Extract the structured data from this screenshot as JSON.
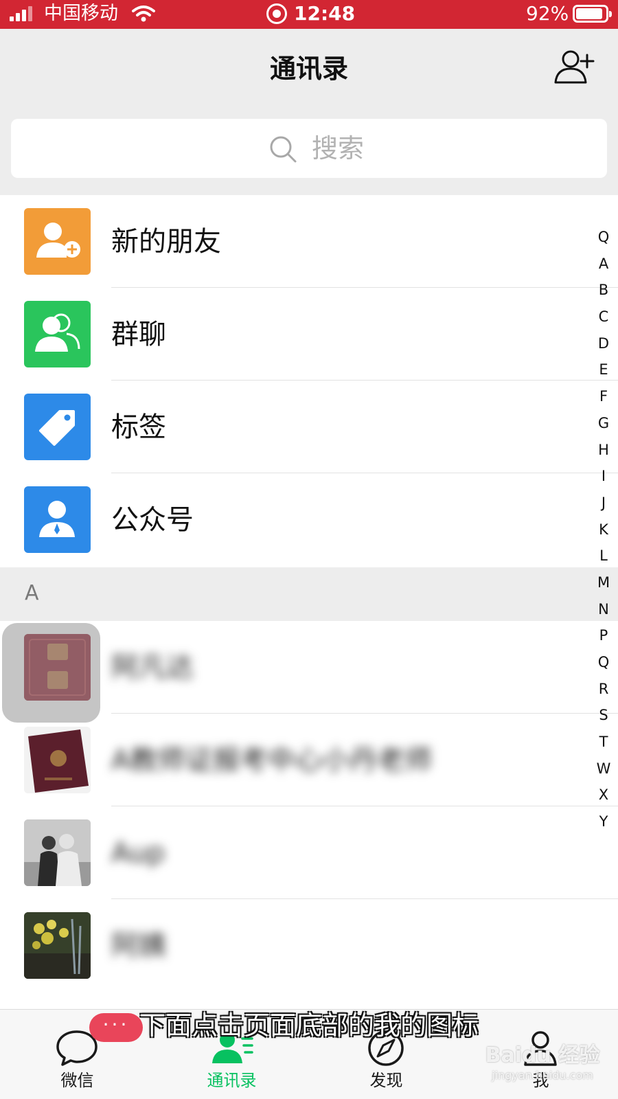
{
  "status_bar": {
    "carrier": "中国移动",
    "time": "12:48",
    "battery_percent": "92%",
    "battery_level": 0.92,
    "background_color": "#d22633",
    "icons": [
      "signal-icon",
      "wifi-icon",
      "screen-record-icon",
      "battery-icon"
    ]
  },
  "header": {
    "title": "通讯录",
    "add_contact_icon": "add-contact-icon"
  },
  "search": {
    "placeholder": "搜索",
    "icon": "search-icon"
  },
  "entries": [
    {
      "label": "新的朋友",
      "icon": "new-friend-icon",
      "color": "#f29c38"
    },
    {
      "label": "群聊",
      "icon": "group-chat-icon",
      "color": "#2ac55c"
    },
    {
      "label": "标签",
      "icon": "tag-icon",
      "color": "#2d8ae8"
    },
    {
      "label": "公众号",
      "icon": "official-account-icon",
      "color": "#2d8ae8"
    }
  ],
  "section": {
    "letter": "A"
  },
  "contacts": [
    {
      "name": "阿凡达",
      "avatar": "avatar-fortune"
    },
    {
      "name": "A教师证报考中心小丹老师",
      "avatar": "avatar-passport"
    },
    {
      "name": "Aup",
      "avatar": "avatar-couple-photo"
    },
    {
      "name": "阿姨",
      "avatar": "avatar-flowers"
    }
  ],
  "index_letters": [
    "Q",
    "A",
    "B",
    "C",
    "D",
    "E",
    "F",
    "G",
    "H",
    "I",
    "J",
    "K",
    "L",
    "M",
    "N",
    "P",
    "Q",
    "R",
    "S",
    "T",
    "W",
    "X",
    "Y"
  ],
  "tabs": [
    {
      "label": "微信",
      "icon": "chat-icon",
      "active": false
    },
    {
      "label": "通讯录",
      "icon": "contacts-icon",
      "active": true
    },
    {
      "label": "发现",
      "icon": "discover-icon",
      "active": false
    },
    {
      "label": "我",
      "icon": "me-icon",
      "active": false
    }
  ],
  "overlay": {
    "subtitle": "下面点击页面底部的我的图标",
    "more_pill": "···",
    "watermark": "Baidu 经验",
    "watermark_sub": "jingyan.baidu.com"
  },
  "colors": {
    "accent_green": "#07c160",
    "nav_background": "#ededed"
  }
}
